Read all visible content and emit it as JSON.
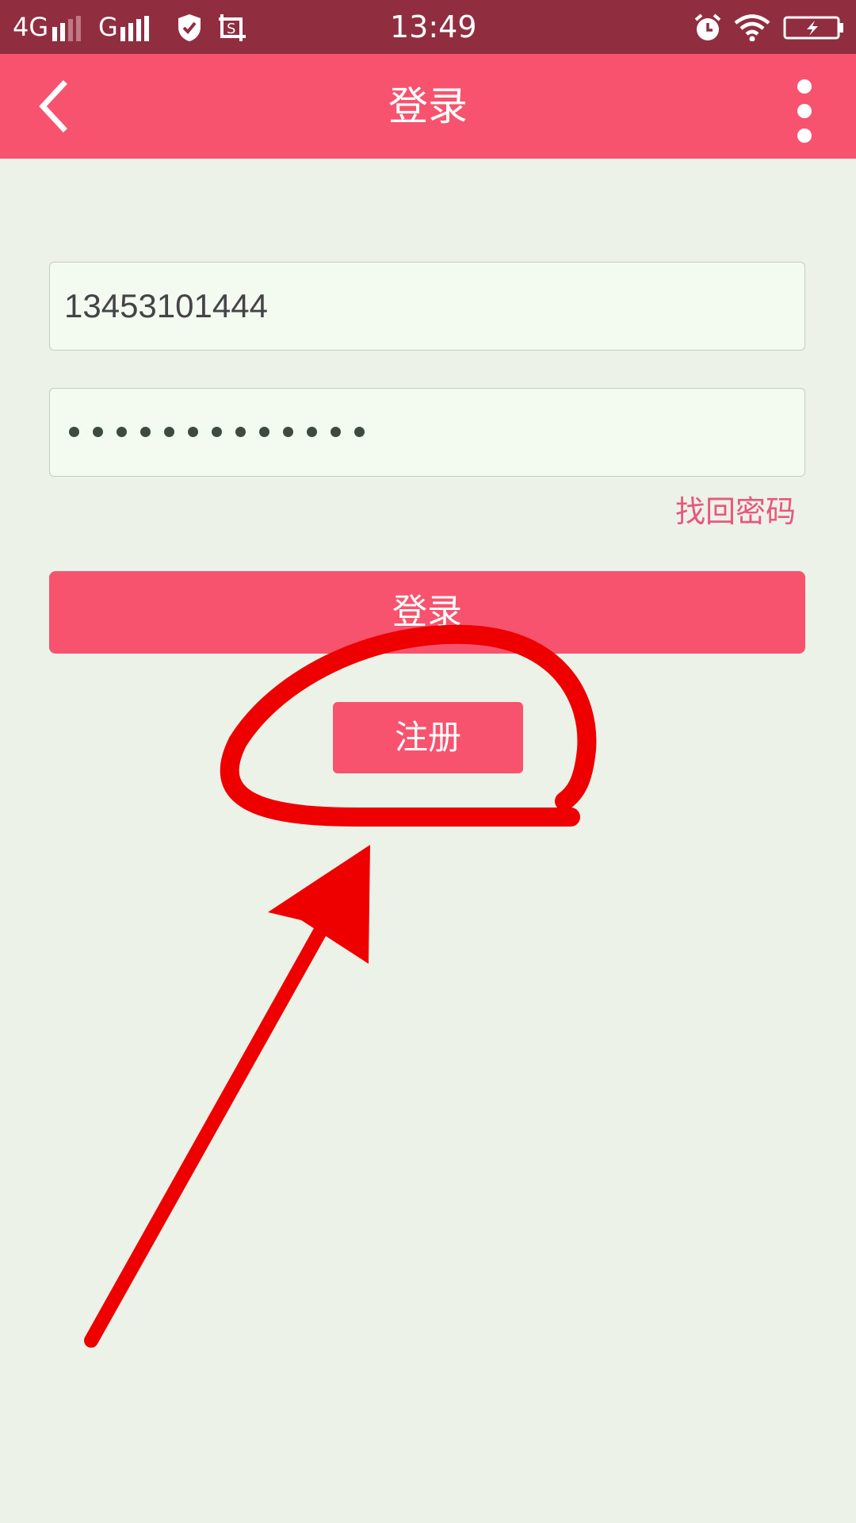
{
  "status_bar": {
    "network_1": "4G",
    "network_2": "G",
    "time": "13:49",
    "icons": [
      "signal-icon",
      "shield-icon",
      "screenshot-icon",
      "alarm-icon",
      "wifi-icon",
      "battery-charging-icon"
    ]
  },
  "app_bar": {
    "title": "登录",
    "icons": [
      "back-arrow-icon",
      "more-vertical-icon"
    ]
  },
  "form": {
    "phone_value": "13453101444",
    "password_mask_count": 13,
    "forgot_label": "找回密码",
    "login_label": "登录",
    "register_label": "注册"
  },
  "colors": {
    "status_bar": "#902e40",
    "brand_pink": "#f7536e",
    "background": "#ecf2e8",
    "link_pink": "#e8587a",
    "annotation_red": "#ee0000"
  }
}
